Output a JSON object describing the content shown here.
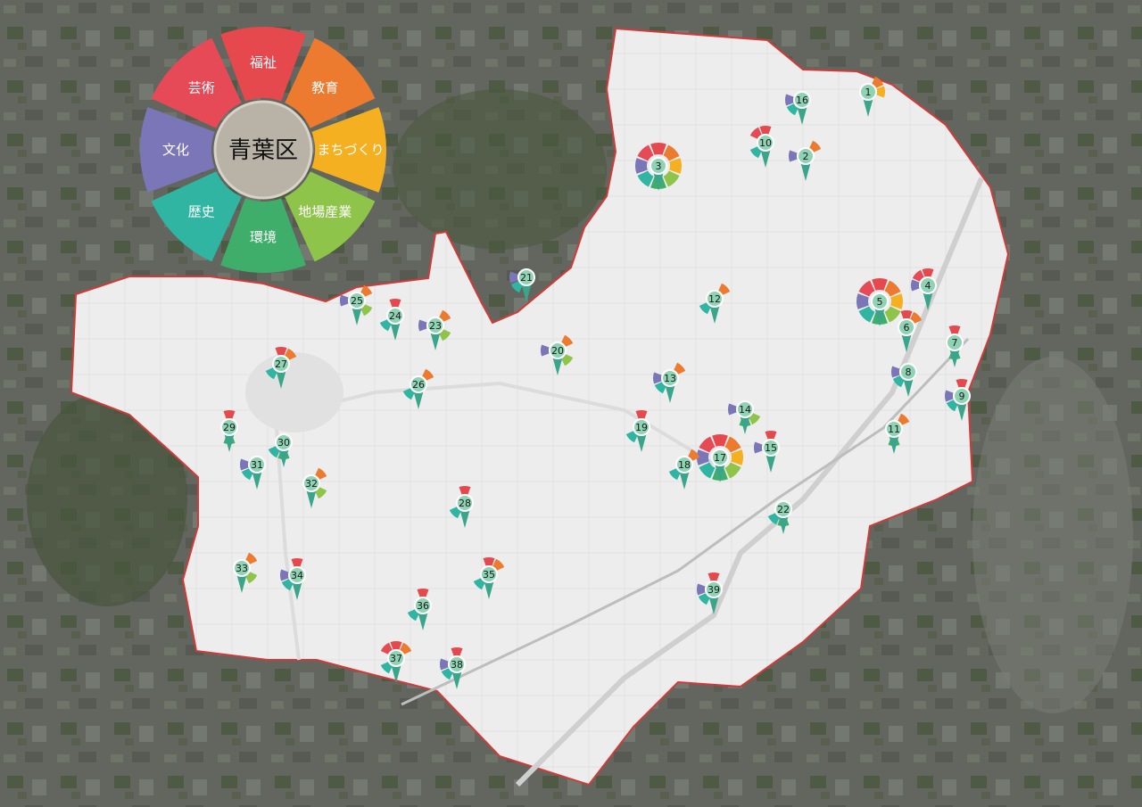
{
  "map": {
    "ward_name": "青葉区"
  },
  "legend": {
    "categories": [
      {
        "key": "welfare",
        "label": "福祉",
        "color": "#e5484d"
      },
      {
        "key": "education",
        "label": "教育",
        "color": "#ec7a2f"
      },
      {
        "key": "town",
        "label": "まちづくり",
        "color": "#f5b022"
      },
      {
        "key": "industry",
        "label": "地場産業",
        "color": "#8fc44a"
      },
      {
        "key": "environment",
        "label": "環境",
        "color": "#3fae6a"
      },
      {
        "key": "history",
        "label": "歴史",
        "color": "#2fb5a2"
      },
      {
        "key": "culture",
        "label": "文化",
        "color": "#7b76b8"
      },
      {
        "key": "art",
        "label": "芸術",
        "color": "#e64a57"
      }
    ]
  },
  "markers": [
    {
      "label": "1",
      "cats": [
        "education",
        "town"
      ]
    },
    {
      "label": "2",
      "cats": [
        "culture",
        "education"
      ]
    },
    {
      "label": "3",
      "cats": [
        "welfare",
        "education",
        "town",
        "industry",
        "environment",
        "history",
        "culture",
        "art"
      ]
    },
    {
      "label": "4",
      "cats": [
        "art",
        "welfare",
        "culture"
      ]
    },
    {
      "label": "5",
      "cats": [
        "welfare",
        "education",
        "town",
        "industry",
        "environment",
        "history",
        "culture",
        "art"
      ]
    },
    {
      "label": "6",
      "cats": [
        "education",
        "welfare"
      ]
    },
    {
      "label": "7",
      "cats": [
        "welfare",
        "environment"
      ]
    },
    {
      "label": "8",
      "cats": [
        "culture",
        "history"
      ]
    },
    {
      "label": "9",
      "cats": [
        "welfare",
        "culture",
        "history"
      ]
    },
    {
      "label": "10",
      "cats": [
        "welfare",
        "art",
        "history"
      ]
    },
    {
      "label": "11",
      "cats": [
        "education",
        "environment"
      ]
    },
    {
      "label": "12",
      "cats": [
        "education",
        "history"
      ]
    },
    {
      "label": "13",
      "cats": [
        "education",
        "culture",
        "history"
      ]
    },
    {
      "label": "14",
      "cats": [
        "culture",
        "industry",
        "environment"
      ]
    },
    {
      "label": "15",
      "cats": [
        "welfare",
        "culture"
      ]
    },
    {
      "label": "16",
      "cats": [
        "culture",
        "history"
      ]
    },
    {
      "label": "17",
      "cats": [
        "welfare",
        "education",
        "town",
        "industry",
        "environment",
        "history",
        "culture",
        "art"
      ]
    },
    {
      "label": "18",
      "cats": [
        "education",
        "history"
      ]
    },
    {
      "label": "19",
      "cats": [
        "welfare",
        "history"
      ]
    },
    {
      "label": "20",
      "cats": [
        "education",
        "culture",
        "industry"
      ]
    },
    {
      "label": "21",
      "cats": [
        "culture",
        "history"
      ]
    },
    {
      "label": "22",
      "cats": [
        "environment",
        "history"
      ]
    },
    {
      "label": "23",
      "cats": [
        "education",
        "culture",
        "industry"
      ]
    },
    {
      "label": "24",
      "cats": [
        "welfare",
        "history"
      ]
    },
    {
      "label": "25",
      "cats": [
        "education",
        "culture",
        "industry"
      ]
    },
    {
      "label": "26",
      "cats": [
        "education",
        "history"
      ]
    },
    {
      "label": "27",
      "cats": [
        "welfare",
        "education",
        "history"
      ]
    },
    {
      "label": "28",
      "cats": [
        "welfare",
        "history"
      ]
    },
    {
      "label": "29",
      "cats": [
        "welfare",
        "environment"
      ]
    },
    {
      "label": "30",
      "cats": [
        "history",
        "environment"
      ]
    },
    {
      "label": "31",
      "cats": [
        "culture",
        "history"
      ]
    },
    {
      "label": "32",
      "cats": [
        "education",
        "industry"
      ]
    },
    {
      "label": "33",
      "cats": [
        "education",
        "industry"
      ]
    },
    {
      "label": "34",
      "cats": [
        "welfare",
        "culture",
        "history"
      ]
    },
    {
      "label": "35",
      "cats": [
        "welfare",
        "education",
        "history"
      ]
    },
    {
      "label": "36",
      "cats": [
        "welfare",
        "history"
      ]
    },
    {
      "label": "37",
      "cats": [
        "welfare",
        "education",
        "art",
        "history"
      ]
    },
    {
      "label": "38",
      "cats": [
        "welfare",
        "culture",
        "history"
      ]
    },
    {
      "label": "39",
      "cats": [
        "welfare",
        "culture",
        "history"
      ]
    }
  ]
}
